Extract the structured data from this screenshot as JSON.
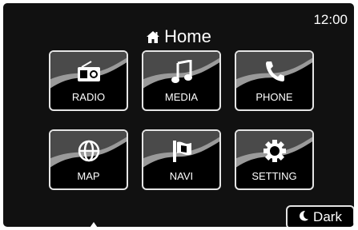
{
  "status": {
    "time": "12:00"
  },
  "header": {
    "title": "Home",
    "icon": "home-icon"
  },
  "menu": [
    {
      "label": "RADIO",
      "icon": "radio-icon"
    },
    {
      "label": "MEDIA",
      "icon": "music-note-icon"
    },
    {
      "label": "PHONE",
      "icon": "phone-icon"
    },
    {
      "label": "MAP",
      "icon": "globe-icon"
    },
    {
      "label": "NAVI",
      "icon": "flag-icon"
    },
    {
      "label": "SETTING",
      "icon": "gear-icon"
    }
  ],
  "theme_toggle": {
    "label": "Dark",
    "icon": "moon-icon"
  },
  "colors": {
    "background": "#111111",
    "tile_border": "#e5e5e5",
    "text": "#ffffff"
  }
}
